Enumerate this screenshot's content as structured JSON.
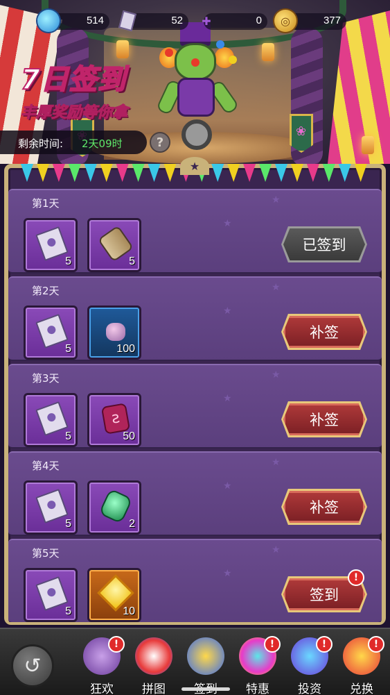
{
  "currency": {
    "gems": "514",
    "tickets": "52",
    "puzzle": "0",
    "coins": "377"
  },
  "banner": {
    "title": "7日签到",
    "subtitle": "丰厚奖励等你拿",
    "timer_label": "剩余时间:",
    "timer_value": "2天09时",
    "help": "?"
  },
  "days": [
    {
      "label": "第1天",
      "rewards": [
        {
          "icon": "ticket",
          "qty": "5"
        },
        {
          "icon": "scroll",
          "qty": "5"
        }
      ],
      "button": "已签到",
      "state": "claimed"
    },
    {
      "label": "第2天",
      "rewards": [
        {
          "icon": "ticket",
          "qty": "5"
        },
        {
          "icon": "pink-stone",
          "qty": "100"
        }
      ],
      "button": "补签",
      "state": "makeup"
    },
    {
      "label": "第3天",
      "rewards": [
        {
          "icon": "ticket",
          "qty": "5"
        },
        {
          "icon": "red-rune",
          "qty": "50"
        }
      ],
      "button": "补签",
      "state": "makeup"
    },
    {
      "label": "第4天",
      "rewards": [
        {
          "icon": "ticket",
          "qty": "5"
        },
        {
          "icon": "emerald",
          "qty": "2"
        }
      ],
      "button": "补签",
      "state": "makeup"
    },
    {
      "label": "第5天",
      "rewards": [
        {
          "icon": "ticket",
          "qty": "5"
        },
        {
          "icon": "yellow-gem",
          "qty": "10"
        }
      ],
      "button": "签到",
      "state": "available"
    }
  ],
  "nav": {
    "back": "↺",
    "items": [
      {
        "label": "狂欢",
        "badge": "!"
      },
      {
        "label": "拼图",
        "badge": ""
      },
      {
        "label": "签到",
        "badge": ""
      },
      {
        "label": "特惠",
        "badge": "!"
      },
      {
        "label": "投资",
        "badge": "!"
      },
      {
        "label": "兑换",
        "badge": "!"
      }
    ]
  },
  "badge_symbol": "!",
  "colors": {
    "accent_red": "#7a1f24",
    "timer_green": "#5ee86a",
    "panel_purple": "#5b3f7d",
    "gold_border": "#c9b27a"
  }
}
